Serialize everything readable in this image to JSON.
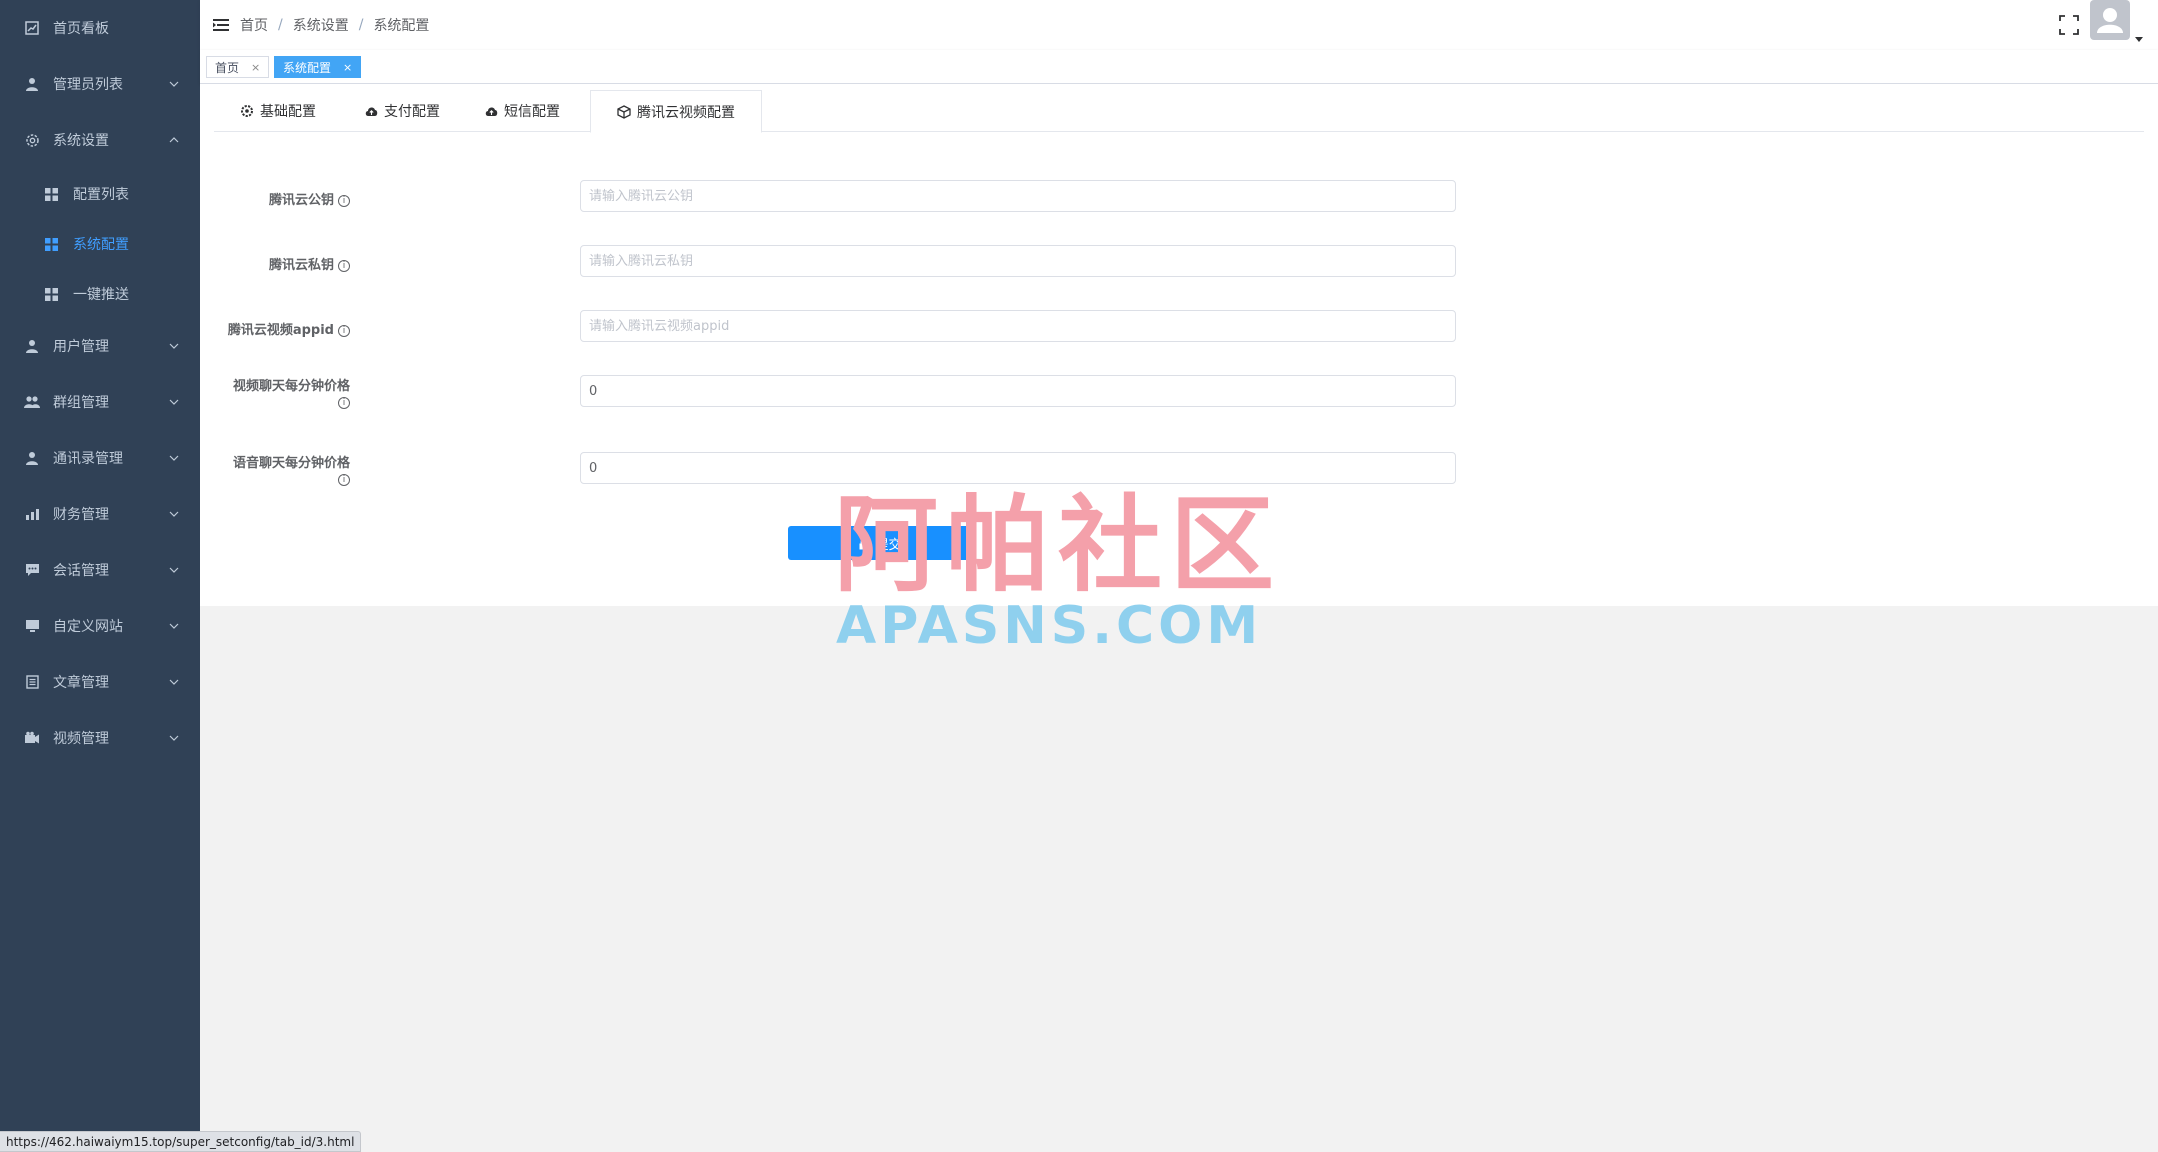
{
  "sidebar": {
    "items": [
      {
        "label": "首页看板",
        "icon": "chart-icon"
      },
      {
        "label": "管理员列表",
        "icon": "user-icon"
      },
      {
        "label": "系统设置",
        "icon": "gear-icon"
      },
      {
        "label": "用户管理",
        "icon": "user-icon"
      },
      {
        "label": "群组管理",
        "icon": "group-icon"
      },
      {
        "label": "通讯录管理",
        "icon": "contact-icon"
      },
      {
        "label": "财务管理",
        "icon": "finance-icon"
      },
      {
        "label": "会话管理",
        "icon": "chat-icon"
      },
      {
        "label": "自定义网站",
        "icon": "monitor-icon"
      },
      {
        "label": "文章管理",
        "icon": "article-icon"
      },
      {
        "label": "视频管理",
        "icon": "video-icon"
      }
    ],
    "sub_items": [
      {
        "label": "配置列表"
      },
      {
        "label": "系统配置"
      },
      {
        "label": "一键推送"
      }
    ],
    "active_color": "#409eff",
    "bg_color": "#304156"
  },
  "breadcrumb": {
    "items": [
      "首页",
      "系统设置",
      "系统配置"
    ],
    "separator": "/"
  },
  "tags_view": {
    "tags": [
      {
        "label": "首页",
        "close": "×"
      },
      {
        "label": "系统配置",
        "close": "×"
      }
    ]
  },
  "tabs": [
    {
      "label": "基础配置",
      "icon": "gear-icon"
    },
    {
      "label": "支付配置",
      "icon": "cloud-icon"
    },
    {
      "label": "短信配置",
      "icon": "cloud-icon"
    },
    {
      "label": "腾讯云视频配置",
      "icon": "cube-icon"
    }
  ],
  "form": {
    "fields": [
      {
        "label": "腾讯云公钥",
        "placeholder": "请输入腾讯云公钥",
        "value": ""
      },
      {
        "label": "腾讯云私钥",
        "placeholder": "请输入腾讯云私钥",
        "value": ""
      },
      {
        "label": "腾讯云视频appid",
        "placeholder": "请输入腾讯云视频appid",
        "value": ""
      },
      {
        "label": "视频聊天每分钟价格",
        "placeholder": "",
        "value": "0"
      },
      {
        "label": "语音聊天每分钟价格",
        "placeholder": "",
        "value": "0"
      }
    ],
    "info_glyph": "i",
    "submit_label": "提交"
  },
  "watermark": {
    "cn": "阿帕社区",
    "en": "APASNS.COM"
  },
  "status_bar": {
    "url": "https://462.haiwaiym15.top/super_setconfig/tab_id/3.html"
  }
}
